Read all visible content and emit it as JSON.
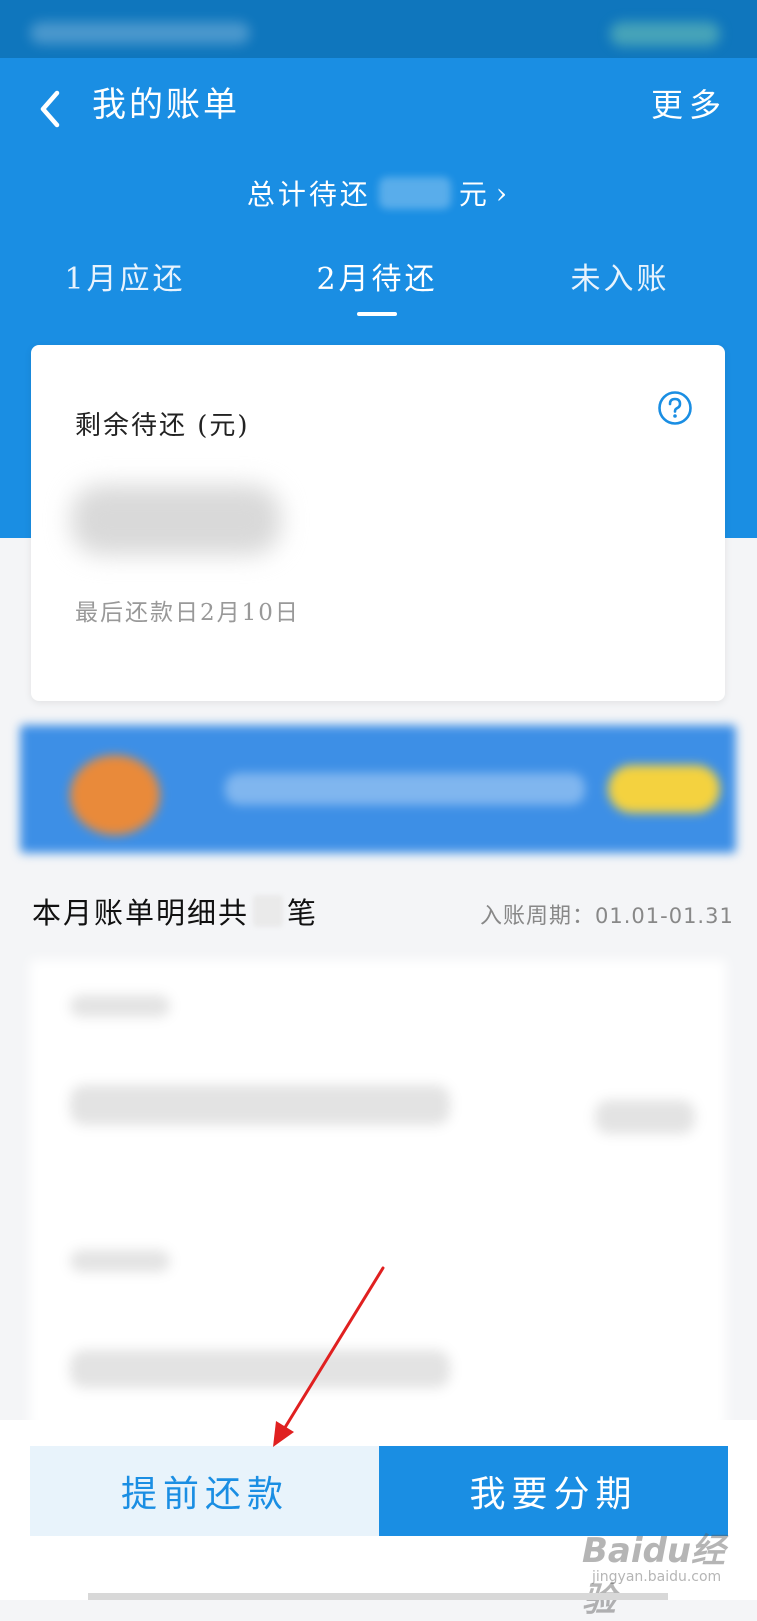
{
  "header": {
    "title": "我的账单",
    "more_label": "更多",
    "total_prefix": "总计待还",
    "total_unit": "元",
    "total_chevron": "›"
  },
  "tabs": [
    {
      "label": "1月应还",
      "active": false
    },
    {
      "label": "2月待还",
      "active": true
    },
    {
      "label": "未入账",
      "active": false
    }
  ],
  "summary_card": {
    "label": "剩余待还 (元)",
    "help_icon": "question-circle-icon",
    "due_text": "最后还款日2月10日"
  },
  "details": {
    "title_prefix": "本月账单明细共",
    "title_suffix": "笔",
    "period_label": "入账周期：",
    "period_value": "01.01-01.31"
  },
  "actions": {
    "prepay_label": "提前还款",
    "installment_label": "我要分期"
  },
  "watermark": {
    "brand": "Baidu经验",
    "url": "jingyan.baidu.com"
  },
  "colors": {
    "primary": "#1a8ee3",
    "status_bar": "#0f76bd",
    "prepay_bg": "#e8f3fb",
    "annotation_arrow": "#e02020"
  }
}
